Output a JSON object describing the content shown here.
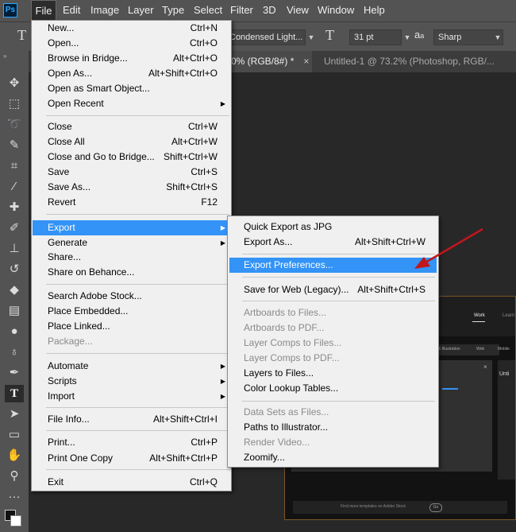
{
  "app": {
    "logo": "Ps"
  },
  "menubar": {
    "items": [
      "File",
      "Edit",
      "Image",
      "Layer",
      "Type",
      "Select",
      "Filter",
      "3D",
      "View",
      "Window",
      "Help"
    ]
  },
  "options_bar": {
    "tool_glyph": "T",
    "font_style": "Condensed Light...",
    "size_icon_glyph": "T",
    "font_size": "31 pt",
    "aa_glyph": "a",
    "aa_sub": "a",
    "anti_alias": "Sharp"
  },
  "tabs": [
    "0% (RGB/8#) *",
    "×",
    "Untitled-1 @ 73.2% (Photoshop, RGB/..."
  ],
  "file_menu": {
    "items": [
      {
        "label": "New...",
        "shortcut": "Ctrl+N"
      },
      {
        "label": "Open...",
        "shortcut": "Ctrl+O"
      },
      {
        "label": "Browse in Bridge...",
        "shortcut": "Alt+Ctrl+O"
      },
      {
        "label": "Open As...",
        "shortcut": "Alt+Shift+Ctrl+O"
      },
      {
        "label": "Open as Smart Object...",
        "shortcut": ""
      },
      {
        "label": "Open Recent",
        "shortcut": "",
        "submenu": true
      },
      {
        "label": "Close",
        "shortcut": "Ctrl+W"
      },
      {
        "label": "Close All",
        "shortcut": "Alt+Ctrl+W"
      },
      {
        "label": "Close and Go to Bridge...",
        "shortcut": "Shift+Ctrl+W"
      },
      {
        "label": "Save",
        "shortcut": "Ctrl+S"
      },
      {
        "label": "Save As...",
        "shortcut": "Shift+Ctrl+S"
      },
      {
        "label": "Revert",
        "shortcut": "F12"
      },
      {
        "label": "Export",
        "shortcut": "",
        "submenu": true,
        "highlighted": true
      },
      {
        "label": "Generate",
        "shortcut": "",
        "submenu": true
      },
      {
        "label": "Share...",
        "shortcut": ""
      },
      {
        "label": "Share on Behance...",
        "shortcut": ""
      },
      {
        "label": "Search Adobe Stock...",
        "shortcut": ""
      },
      {
        "label": "Place Embedded...",
        "shortcut": ""
      },
      {
        "label": "Place Linked...",
        "shortcut": ""
      },
      {
        "label": "Package...",
        "shortcut": "",
        "disabled": true
      },
      {
        "label": "Automate",
        "shortcut": "",
        "submenu": true
      },
      {
        "label": "Scripts",
        "shortcut": "",
        "submenu": true
      },
      {
        "label": "Import",
        "shortcut": "",
        "submenu": true
      },
      {
        "label": "File Info...",
        "shortcut": "Alt+Shift+Ctrl+I"
      },
      {
        "label": "Print...",
        "shortcut": "Ctrl+P"
      },
      {
        "label": "Print One Copy",
        "shortcut": "Alt+Shift+Ctrl+P"
      },
      {
        "label": "Exit",
        "shortcut": "Ctrl+Q"
      }
    ]
  },
  "export_submenu": {
    "items": [
      {
        "label": "Quick Export as JPG",
        "shortcut": ""
      },
      {
        "label": "Export As...",
        "shortcut": "Alt+Shift+Ctrl+W"
      },
      {
        "label": "Export Preferences...",
        "shortcut": "",
        "highlighted": true
      },
      {
        "label": "Save for Web (Legacy)...",
        "shortcut": "Alt+Shift+Ctrl+S"
      },
      {
        "label": "Artboards to Files...",
        "shortcut": "",
        "disabled": true
      },
      {
        "label": "Artboards to PDF...",
        "shortcut": "",
        "disabled": true
      },
      {
        "label": "Layer Comps to Files...",
        "shortcut": "",
        "disabled": true
      },
      {
        "label": "Layer Comps to PDF...",
        "shortcut": "",
        "disabled": true
      },
      {
        "label": "Layers to Files...",
        "shortcut": ""
      },
      {
        "label": "Color Lookup Tables...",
        "shortcut": ""
      },
      {
        "label": "Data Sets as Files...",
        "shortcut": "",
        "disabled": true
      },
      {
        "label": "Paths to Illustrator...",
        "shortcut": ""
      },
      {
        "label": "Render Video...",
        "shortcut": "",
        "disabled": true
      },
      {
        "label": "Zoomify...",
        "shortcut": ""
      }
    ]
  },
  "embedded_screenshot": {
    "nav_active": "Work",
    "nav_other": "Learn",
    "tabs": [
      "& Illustration",
      "Web",
      "Mobile"
    ],
    "panel_title": "Unti",
    "footer_text": "Find more templates on Adobe Stock",
    "footer_btn": "Go"
  },
  "colors": {
    "accent": "#3393f6",
    "annotation_arrow": "#c0161c"
  }
}
